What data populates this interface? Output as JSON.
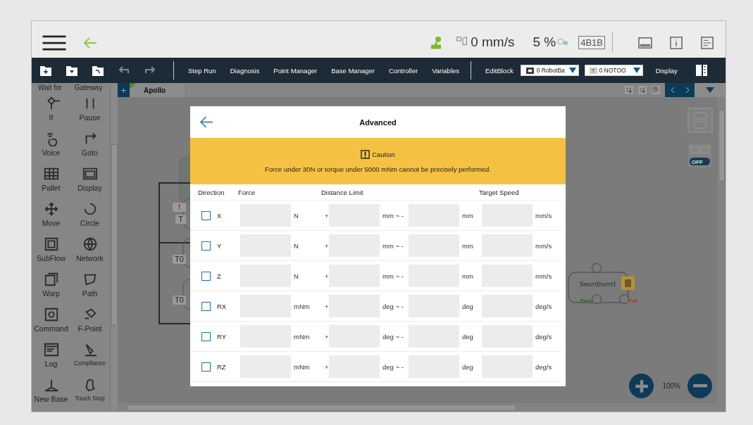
{
  "top_bar": {
    "speed": "0 mm/s",
    "percent": "5 %",
    "mode": "4B1B"
  },
  "toolbar": {
    "menu": [
      "Step Run",
      "Diagnosis",
      "Point Manager",
      "Base Manager",
      "Controller",
      "Variables"
    ],
    "edit_block": "EditBlock",
    "dropdowns": [
      {
        "value": "0 RobotBa"
      },
      {
        "badge": "T",
        "value": "0 NOTOO"
      }
    ],
    "display": "Display"
  },
  "sidebar": {
    "cut_row": [
      "Wait for",
      "Gateway"
    ],
    "items": [
      {
        "label": "If"
      },
      {
        "label": "Pause"
      },
      {
        "label": "Voice"
      },
      {
        "label": "Goto"
      },
      {
        "label": "Pallet"
      },
      {
        "label": "Display"
      },
      {
        "label": "Move"
      },
      {
        "label": "Circle"
      },
      {
        "label": "SubFlow"
      },
      {
        "label": "Network"
      },
      {
        "label": "Warp"
      },
      {
        "label": "Path"
      },
      {
        "label": "Command"
      },
      {
        "label": "F-Point"
      },
      {
        "label": "Log"
      },
      {
        "label": "Compliance"
      },
      {
        "label": "New Base"
      },
      {
        "label": "Touch Stop"
      }
    ]
  },
  "canvas": {
    "add_tab": "+",
    "tab": "Apollo",
    "badges": [
      "!",
      "T",
      "T0",
      "T0"
    ],
    "node": {
      "name": "SmartInsert1",
      "pass": "Pass",
      "fail": "Fail"
    },
    "toggle": "OFF",
    "zoom": "100%"
  },
  "dialog": {
    "title": "Advanced",
    "caution_title": "Caution",
    "caution_text": "Force under 30N or torque under 5000 mNm cannot be precisely performed.",
    "columns": [
      "Direction",
      "Force",
      "Distance Limit",
      "Target Speed"
    ],
    "rows": [
      {
        "axis": "X",
        "checked": false,
        "force_unit": "N",
        "sign": "+",
        "range_unit": "mm ~ -",
        "limit_unit": "mm",
        "speed_unit": "mm/s"
      },
      {
        "axis": "Y",
        "checked": false,
        "force_unit": "N",
        "sign": "+",
        "range_unit": "mm ~ -",
        "limit_unit": "mm",
        "speed_unit": "mm/s"
      },
      {
        "axis": "Z",
        "checked": false,
        "force_unit": "N",
        "sign": "+",
        "range_unit": "mm ~ -",
        "limit_unit": "mm",
        "speed_unit": "mm/s"
      },
      {
        "axis": "RX",
        "checked": false,
        "force_unit": "mNm",
        "sign": "+",
        "range_unit": "deg ~ -",
        "limit_unit": "deg",
        "speed_unit": "deg/s"
      },
      {
        "axis": "RY",
        "checked": false,
        "force_unit": "mNm",
        "sign": "+",
        "range_unit": "deg ~ -",
        "limit_unit": "deg",
        "speed_unit": "deg/s"
      },
      {
        "axis": "RZ",
        "checked": false,
        "force_unit": "mNm",
        "sign": "+",
        "range_unit": "deg ~ -",
        "limit_unit": "deg",
        "speed_unit": "deg/s"
      }
    ]
  }
}
